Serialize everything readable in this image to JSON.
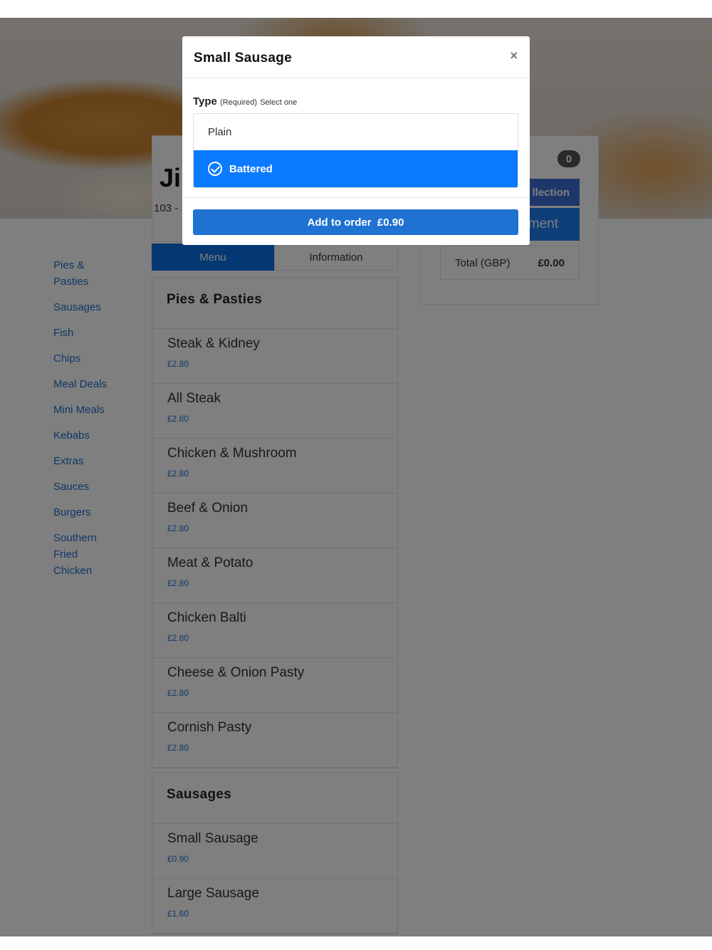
{
  "restaurant": {
    "name_partial": "Ji",
    "address_partial": "103 -"
  },
  "sidebar": {
    "links": [
      "Pies & Pasties",
      "Sausages",
      "Fish",
      "Chips",
      "Meal Deals",
      "Mini Meals",
      "Kebabs",
      "Extras",
      "Sauces",
      "Burgers",
      "Southern Fried Chicken"
    ]
  },
  "tabs": {
    "menu": "Menu",
    "information": "Information"
  },
  "sections": [
    {
      "title": "Pies & Pasties",
      "items": [
        {
          "name": "Steak & Kidney",
          "price": "£2.80"
        },
        {
          "name": "All Steak",
          "price": "£2.80"
        },
        {
          "name": "Chicken & Mushroom",
          "price": "£2.80"
        },
        {
          "name": "Beef & Onion",
          "price": "£2.80"
        },
        {
          "name": "Meat & Potato",
          "price": "£2.80"
        },
        {
          "name": "Chicken Balti",
          "price": "£2.80"
        },
        {
          "name": "Cheese & Onion Pasty",
          "price": "£2.80"
        },
        {
          "name": "Cornish Pasty",
          "price": "£2.80"
        }
      ]
    },
    {
      "title": "Sausages",
      "items": [
        {
          "name": "Small Sausage",
          "price": "£0.90"
        },
        {
          "name": "Large Sausage",
          "price": "£1.60"
        }
      ]
    }
  ],
  "basket": {
    "count": "0",
    "collection_partial": "llection",
    "payment_partial": "ment",
    "total_label": "Total (GBP)",
    "total_value": "£0.00"
  },
  "modal": {
    "title": "Small Sausage",
    "close": "×",
    "type_label": "Type",
    "type_required": "(Required)",
    "type_hint": "Select one",
    "options": [
      "Plain",
      "Battered"
    ],
    "selected": "Battered",
    "add_button": "Add to order  £0.90"
  },
  "colors": {
    "primary": "#0a7bff",
    "link": "#1f6fd1",
    "overlay": "rgba(0,0,0,0.5)"
  }
}
